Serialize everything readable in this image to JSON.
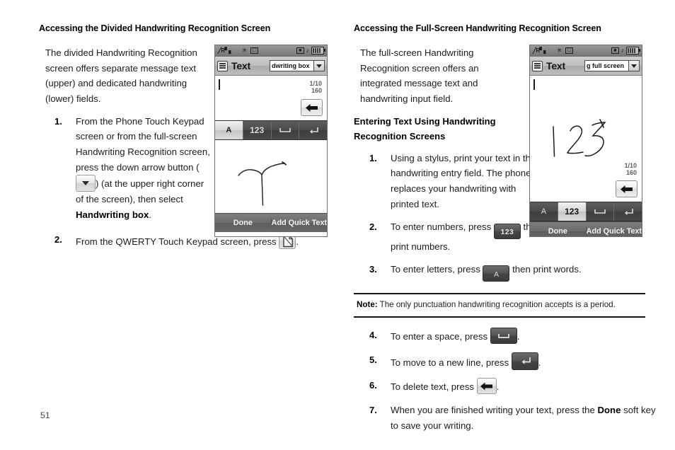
{
  "page": {
    "number": "51"
  },
  "left_column": {
    "heading": "Accessing the Divided Handwriting Recognition Screen",
    "intro": "The divided Handwriting Recognition screen offers separate message text (upper) and dedicated handwriting (lower) fields.",
    "steps": [
      {
        "num": "1.",
        "text_before": "From the Phone Touch Keypad screen or from the full-screen Handwriting Recognition screen, press the down arrow button (",
        "icon": "chevron-down-icon",
        "text_middle": ") (at the upper right corner of the screen), then select ",
        "bold": "Handwriting box",
        "text_after": "."
      },
      {
        "num": "2.",
        "text_before": "From the QWERTY Touch Keypad screen, press ",
        "icon": "document-page-icon",
        "text_after": "."
      }
    ]
  },
  "right_column": {
    "heading": "Accessing the Full-Screen Handwriting Recognition Screen",
    "intro": "The full-screen Handwriting Recognition screen offers an integrated message text and handwriting input field.",
    "subheading": "Entering Text Using Handwriting Recognition Screens",
    "steps_top": [
      {
        "num": "1.",
        "text": "Using a stylus, print your text in the handwriting entry field. The phone replaces your handwriting with printed text."
      },
      {
        "num": "2.",
        "text_before": "To enter numbers, press ",
        "icon": "numeric-key-123",
        "icon_label": "123",
        "text_after": " then print numbers."
      },
      {
        "num": "3.",
        "text_before": "To enter letters, press ",
        "icon": "alpha-key-A",
        "icon_label": "A",
        "text_after": " then print words."
      }
    ],
    "note": {
      "label": "Note:",
      "text": " The only punctuation handwriting recognition accepts is a period."
    },
    "steps_bottom": [
      {
        "num": "4.",
        "text_before": "To enter a space, press ",
        "icon": "space-key-icon",
        "text_after": "."
      },
      {
        "num": "5.",
        "text_before": "To move to a new line, press ",
        "icon": "enter-key-icon",
        "text_after": "."
      },
      {
        "num": "6.",
        "text_before": "To delete text, press ",
        "icon": "backspace-key-icon",
        "text_after": "."
      },
      {
        "num": "7.",
        "text_before": "When you are finished writing your text, press the ",
        "bold": "Done",
        "text_after": " soft key to save your writing."
      }
    ]
  },
  "phone_left": {
    "status_bar": {
      "signal": "R",
      "icons": [
        "signal-bars-icon",
        "bluetooth-off-icon",
        "message-icon",
        "camera-icon",
        "sound-icon",
        "battery-icon"
      ]
    },
    "title": "Text",
    "dropdown_value": "dwriting box",
    "message_field": {
      "counter_line1": "1/10",
      "counter_line2": "160"
    },
    "key_row": [
      {
        "label": "A",
        "selected": true
      },
      {
        "label": "123",
        "selected": false
      },
      {
        "label": "space",
        "selected": false
      },
      {
        "label": "enter",
        "selected": false
      }
    ],
    "handwriting": "T",
    "soft_keys": [
      "Done",
      "Add Quick Text"
    ]
  },
  "phone_right": {
    "status_bar": {
      "signal": "R",
      "icons": [
        "signal-bars-icon",
        "bluetooth-off-icon",
        "message-icon",
        "camera-icon",
        "sound-icon",
        "battery-icon"
      ]
    },
    "title": "Text",
    "dropdown_value": "g full screen",
    "message_field": {
      "counter_line1": "1/10",
      "counter_line2": "160"
    },
    "key_row": [
      {
        "label": "A",
        "selected": false
      },
      {
        "label": "123",
        "selected": true
      },
      {
        "label": "space",
        "selected": false
      },
      {
        "label": "enter",
        "selected": false
      }
    ],
    "handwriting": "123",
    "soft_keys": [
      "Done",
      "Add Quick Text"
    ]
  }
}
